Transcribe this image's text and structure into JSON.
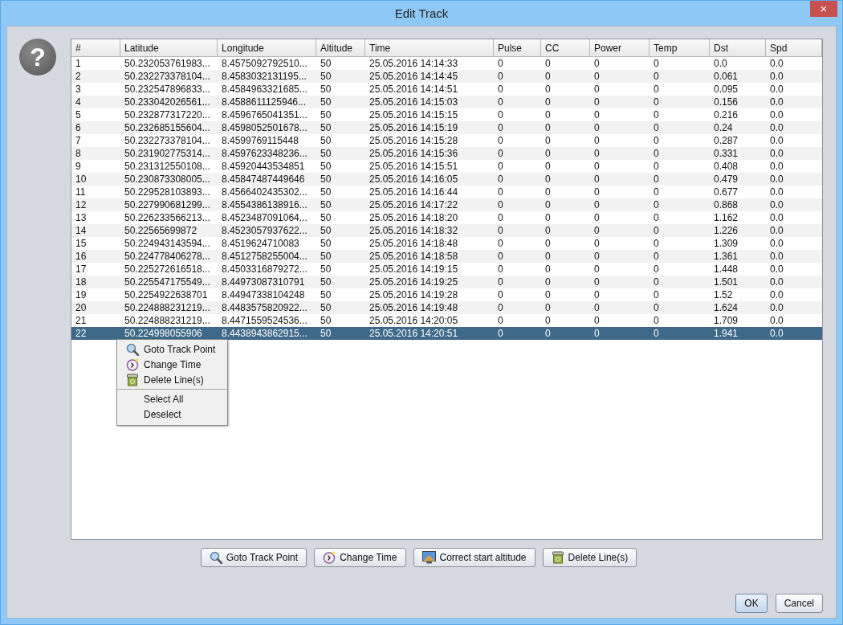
{
  "window": {
    "title": "Edit Track",
    "close_glyph": "×"
  },
  "help_glyph": "?",
  "table": {
    "columns": [
      "#",
      "Latitude",
      "Longitude",
      "Altitude",
      "Time",
      "Pulse",
      "CC",
      "Power",
      "Temp",
      "Dst",
      "Spd"
    ],
    "rows": [
      {
        "selected": false,
        "cells": [
          "1",
          "50.232053761983...",
          "8.4575092792510...",
          "50",
          "25.05.2016 14:14:33",
          "0",
          "0",
          "0",
          "0",
          "0.0",
          "0.0"
        ]
      },
      {
        "selected": false,
        "cells": [
          "2",
          "50.232273378104...",
          "8.4583032131195...",
          "50",
          "25.05.2016 14:14:45",
          "0",
          "0",
          "0",
          "0",
          "0.061",
          "0.0"
        ]
      },
      {
        "selected": false,
        "cells": [
          "3",
          "50.232547896833...",
          "8.4584963321685...",
          "50",
          "25.05.2016 14:14:51",
          "0",
          "0",
          "0",
          "0",
          "0.095",
          "0.0"
        ]
      },
      {
        "selected": false,
        "cells": [
          "4",
          "50.233042026561...",
          "8.4588611125946...",
          "50",
          "25.05.2016 14:15:03",
          "0",
          "0",
          "0",
          "0",
          "0.156",
          "0.0"
        ]
      },
      {
        "selected": false,
        "cells": [
          "5",
          "50.232877317220...",
          "8.4596765041351...",
          "50",
          "25.05.2016 14:15:15",
          "0",
          "0",
          "0",
          "0",
          "0.216",
          "0.0"
        ]
      },
      {
        "selected": false,
        "cells": [
          "6",
          "50.232685155604...",
          "8.4598052501678...",
          "50",
          "25.05.2016 14:15:19",
          "0",
          "0",
          "0",
          "0",
          "0.24",
          "0.0"
        ]
      },
      {
        "selected": false,
        "cells": [
          "7",
          "50.232273378104...",
          "8.4599769115448",
          "50",
          "25.05.2016 14:15:28",
          "0",
          "0",
          "0",
          "0",
          "0.287",
          "0.0"
        ]
      },
      {
        "selected": false,
        "cells": [
          "8",
          "50.231902775314...",
          "8.4597623348236...",
          "50",
          "25.05.2016 14:15:36",
          "0",
          "0",
          "0",
          "0",
          "0.331",
          "0.0"
        ]
      },
      {
        "selected": false,
        "cells": [
          "9",
          "50.231312550108...",
          "8.45920443534851",
          "50",
          "25.05.2016 14:15:51",
          "0",
          "0",
          "0",
          "0",
          "0.408",
          "0.0"
        ]
      },
      {
        "selected": false,
        "cells": [
          "10",
          "50.230873308005...",
          "8.45847487449646",
          "50",
          "25.05.2016 14:16:05",
          "0",
          "0",
          "0",
          "0",
          "0.479",
          "0.0"
        ]
      },
      {
        "selected": false,
        "cells": [
          "11",
          "50.229528103893...",
          "8.4566402435302...",
          "50",
          "25.05.2016 14:16:44",
          "0",
          "0",
          "0",
          "0",
          "0.677",
          "0.0"
        ]
      },
      {
        "selected": false,
        "cells": [
          "12",
          "50.227990681299...",
          "8.4554386138916...",
          "50",
          "25.05.2016 14:17:22",
          "0",
          "0",
          "0",
          "0",
          "0.868",
          "0.0"
        ]
      },
      {
        "selected": false,
        "cells": [
          "13",
          "50.226233566213...",
          "8.4523487091064...",
          "50",
          "25.05.2016 14:18:20",
          "0",
          "0",
          "0",
          "0",
          "1.162",
          "0.0"
        ]
      },
      {
        "selected": false,
        "cells": [
          "14",
          "50.22565699872",
          "8.4523057937622...",
          "50",
          "25.05.2016 14:18:32",
          "0",
          "0",
          "0",
          "0",
          "1.226",
          "0.0"
        ]
      },
      {
        "selected": false,
        "cells": [
          "15",
          "50.224943143594...",
          "8.4519624710083",
          "50",
          "25.05.2016 14:18:48",
          "0",
          "0",
          "0",
          "0",
          "1.309",
          "0.0"
        ]
      },
      {
        "selected": false,
        "cells": [
          "16",
          "50.224778406278...",
          "8.4512758255004...",
          "50",
          "25.05.2016 14:18:58",
          "0",
          "0",
          "0",
          "0",
          "1.361",
          "0.0"
        ]
      },
      {
        "selected": false,
        "cells": [
          "17",
          "50.225272616518...",
          "8.4503316879272...",
          "50",
          "25.05.2016 14:19:15",
          "0",
          "0",
          "0",
          "0",
          "1.448",
          "0.0"
        ]
      },
      {
        "selected": false,
        "cells": [
          "18",
          "50.225547175549...",
          "8.44973087310791",
          "50",
          "25.05.2016 14:19:25",
          "0",
          "0",
          "0",
          "0",
          "1.501",
          "0.0"
        ]
      },
      {
        "selected": false,
        "cells": [
          "19",
          "50.2254922638701",
          "8.44947338104248",
          "50",
          "25.05.2016 14:19:28",
          "0",
          "0",
          "0",
          "0",
          "1.52",
          "0.0"
        ]
      },
      {
        "selected": false,
        "cells": [
          "20",
          "50.224888231219...",
          "8.4483575820922...",
          "50",
          "25.05.2016 14:19:48",
          "0",
          "0",
          "0",
          "0",
          "1.624",
          "0.0"
        ]
      },
      {
        "selected": false,
        "cells": [
          "21",
          "50.224888231219...",
          "8.4471559524536...",
          "50",
          "25.05.2016 14:20:05",
          "0",
          "0",
          "0",
          "0",
          "1.709",
          "0.0"
        ]
      },
      {
        "selected": true,
        "cells": [
          "22",
          "50.224998055906",
          "8.4438943862915...",
          "50",
          "25.05.2016 14:20:51",
          "0",
          "0",
          "0",
          "0",
          "1.941",
          "0.0"
        ]
      }
    ]
  },
  "context_menu": {
    "items": [
      {
        "kind": "goto",
        "label": "Goto Track Point"
      },
      {
        "kind": "retime",
        "label": "Change Time"
      },
      {
        "kind": "delete",
        "label": "Delete Line(s)"
      },
      {
        "kind": "separator"
      },
      {
        "kind": "plain",
        "label": "Select All"
      },
      {
        "kind": "plain",
        "label": "Deselect"
      }
    ]
  },
  "toolbar_buttons": [
    {
      "kind": "goto",
      "label": "Goto Track Point"
    },
    {
      "kind": "retime",
      "label": "Change Time"
    },
    {
      "kind": "altitude",
      "label": "Correct start altitude"
    },
    {
      "kind": "delete",
      "label": "Delete Line(s)"
    }
  ],
  "dialog_buttons": [
    {
      "label": "OK",
      "default": true
    },
    {
      "label": "Cancel",
      "default": false
    }
  ]
}
